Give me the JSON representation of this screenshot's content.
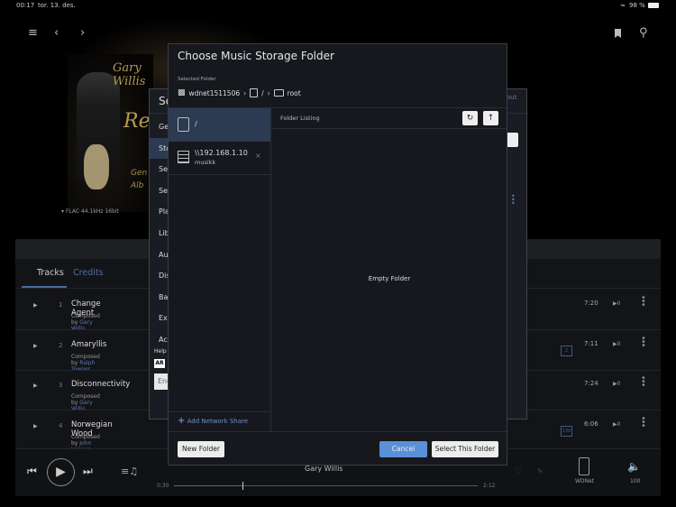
{
  "status_bar": {
    "time": "00:17",
    "date": "tor. 13. des.",
    "battery": "98 %"
  },
  "album": {
    "artist_art": "Gary Willis",
    "title_art": "Re",
    "subtitle_art": "Gen\nAlb",
    "format": "FLAC 44.1kHz 16bit"
  },
  "tabs": [
    "Tracks",
    "Credits"
  ],
  "tracks": [
    {
      "num": "1",
      "title": "Change Agent",
      "composed_label": "Composed by",
      "composers": "Gary Willis",
      "duration": "7:20",
      "plays": "0"
    },
    {
      "num": "2",
      "title": "Amaryllis",
      "composed_label": "Composed by",
      "composers": "Ralph Towner,",
      "duration": "7:11",
      "plays": "0",
      "badge": "2"
    },
    {
      "num": "3",
      "title": "Disconnectivity",
      "composed_label": "Composed by",
      "composers": "Gary Willis",
      "duration": "7:24",
      "plays": "0"
    },
    {
      "num": "4",
      "title": "Norwegian Wood",
      "composed_label": "Composed by",
      "composers": "John Lennon, Paul Mc",
      "duration": "6:06",
      "plays": "0",
      "badge": "138"
    }
  ],
  "player": {
    "artist": "Gary Willis",
    "elapsed": "0:30",
    "total": "2:12",
    "progress": 0.227,
    "device": "WDNet",
    "volume": "100"
  },
  "settings": {
    "title": "Se",
    "items": [
      "Ge",
      "Sto",
      "Ser",
      "Set",
      "Pla",
      "Lib",
      "Aud",
      "Dis",
      "Bac",
      "Ext",
      "Acc"
    ],
    "selected": 1,
    "help": "Help",
    "lang": "Eng",
    "link": "out"
  },
  "dialog": {
    "title": "Choose Music Storage Folder",
    "selected_label": "Selected Folder",
    "breadcrumb": [
      "wdnet1511506",
      "/",
      "root"
    ],
    "locations": [
      {
        "name": "/"
      },
      {
        "name": "\\\\192.168.1.10",
        "sub": "musikk"
      }
    ],
    "add_share": "Add Network Share",
    "listing_header": "Folder Listing",
    "empty": "Empty Folder",
    "new_folder": "New Folder",
    "cancel": "Cancel",
    "select": "Select This Folder"
  }
}
